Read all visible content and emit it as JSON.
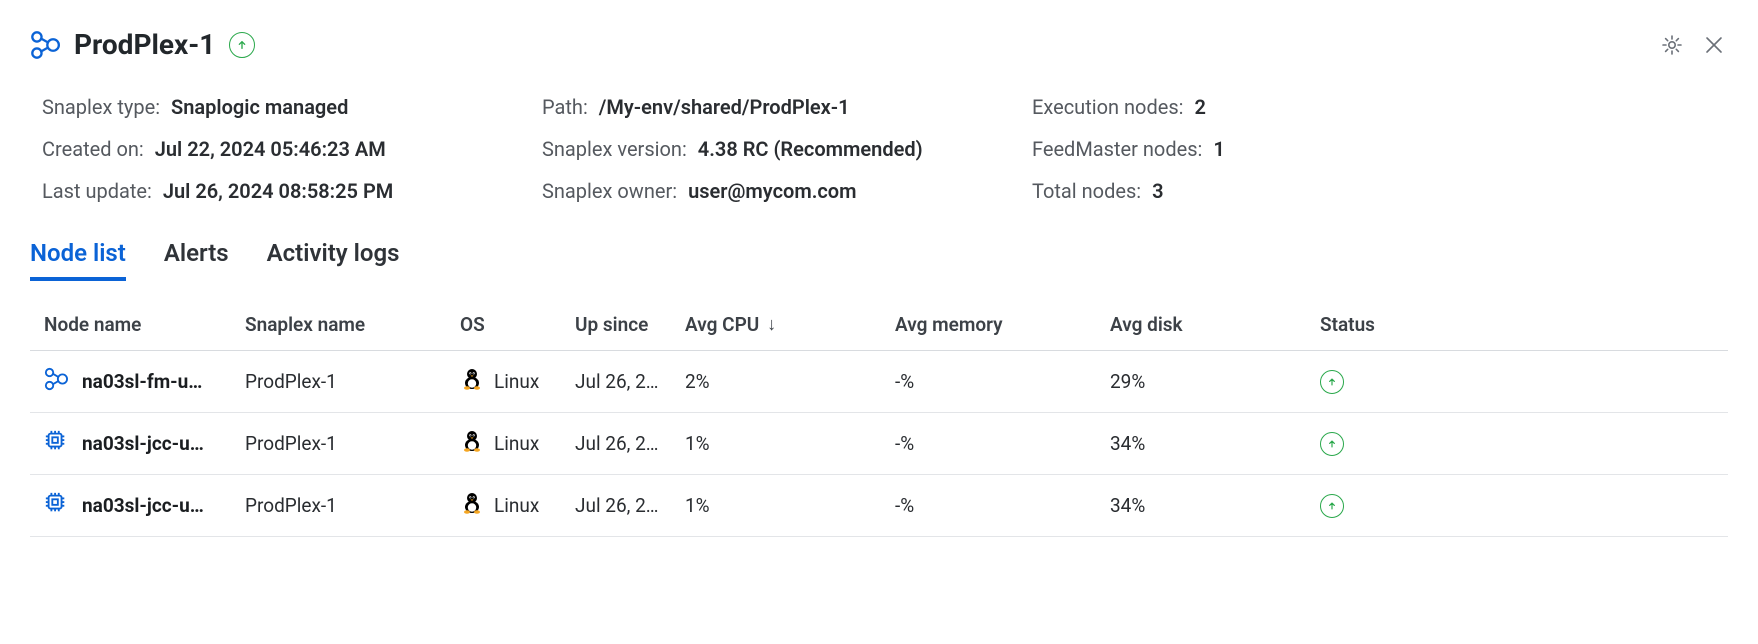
{
  "header": {
    "title": "ProdPlex-1"
  },
  "meta": {
    "snaplex_type_label": "Snaplex type:",
    "snaplex_type_value": "Snaplogic managed",
    "created_on_label": "Created on:",
    "created_on_value": "Jul 22, 2024 05:46:23 AM",
    "last_update_label": "Last update:",
    "last_update_value": "Jul 26, 2024 08:58:25 PM",
    "path_label": "Path:",
    "path_value": "/My-env/shared/ProdPlex-1",
    "version_label": "Snaplex version:",
    "version_value": "4.38 RC (Recommended)",
    "owner_label": "Snaplex owner:",
    "owner_value": "user@mycom.com",
    "exec_nodes_label": "Execution nodes:",
    "exec_nodes_value": "2",
    "fm_nodes_label": "FeedMaster nodes:",
    "fm_nodes_value": "1",
    "total_nodes_label": "Total nodes:",
    "total_nodes_value": "3"
  },
  "tabs": {
    "node_list": "Node list",
    "alerts": "Alerts",
    "activity_logs": "Activity logs"
  },
  "table": {
    "headers": {
      "node_name": "Node name",
      "snaplex_name": "Snaplex name",
      "os": "OS",
      "up_since": "Up since",
      "avg_cpu": "Avg CPU",
      "avg_memory": "Avg memory",
      "avg_disk": "Avg disk",
      "status": "Status"
    },
    "rows": [
      {
        "node_name": "na03sl-fm-u…",
        "snaplex_name": "ProdPlex-1",
        "os": "Linux",
        "up_since": "Jul 26, 2…",
        "avg_cpu": "2%",
        "avg_memory": "-%",
        "avg_disk": "29%",
        "type": "fm"
      },
      {
        "node_name": "na03sl-jcc-u…",
        "snaplex_name": "ProdPlex-1",
        "os": "Linux",
        "up_since": "Jul 26, 2…",
        "avg_cpu": "1%",
        "avg_memory": "-%",
        "avg_disk": "34%",
        "type": "jcc"
      },
      {
        "node_name": "na03sl-jcc-u…",
        "snaplex_name": "ProdPlex-1",
        "os": "Linux",
        "up_since": "Jul 26, 2…",
        "avg_cpu": "1%",
        "avg_memory": "-%",
        "avg_disk": "34%",
        "type": "jcc"
      }
    ]
  }
}
